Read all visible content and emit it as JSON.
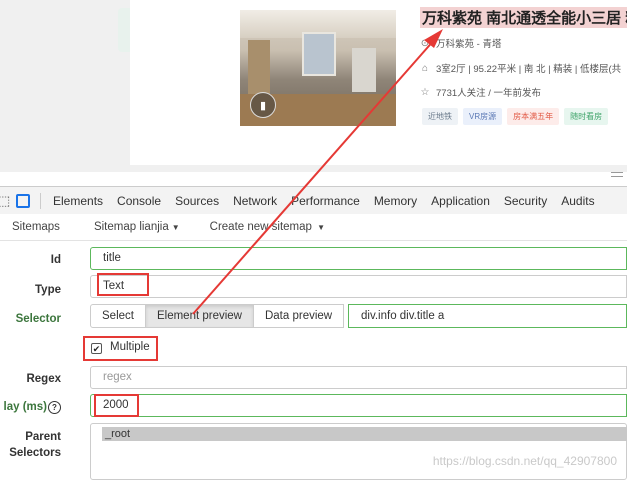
{
  "listing": {
    "title": "万科紫苑 南北通透全能小三居 精",
    "location": "万科紫苑 - 青塔",
    "info": "3室2厅 | 95.22平米 | 南 北 | 精装 | 低楼层(共",
    "follow": "7731人关注 / 一年前发布",
    "tags": [
      "近地铁",
      "VR房源",
      "房本满五年",
      "随时看房"
    ],
    "colors": {
      "title_highlight": "#f3d2d2",
      "tag_vr": "#5a78b5",
      "tag_five_year": "#e25b47",
      "tag_anytime": "#3fa46a"
    }
  },
  "devtools": {
    "tabs": [
      "Elements",
      "Console",
      "Sources",
      "Network",
      "Performance",
      "Memory",
      "Application",
      "Security",
      "Audits"
    ],
    "active_tab_color": "#1a73e8"
  },
  "scraper": {
    "subtabs": {
      "sitemaps": "Sitemaps",
      "sitemap": "Sitemap lianjia",
      "create": "Create new sitemap"
    },
    "form": {
      "id_label": "Id",
      "id_value": "title",
      "type_label": "Type",
      "type_value": "Text",
      "selector_label": "Selector",
      "selector_buttons": [
        "Select",
        "Element preview",
        "Data preview"
      ],
      "selector_value": "div.info div.title a",
      "multiple_label": "Multiple",
      "multiple_checked": "✔",
      "regex_label": "Regex",
      "regex_placeholder": "regex",
      "delay_label": "lay (ms)",
      "delay_value": "2000",
      "parent_label_1": "Parent",
      "parent_label_2": "Selectors",
      "parent_option": "_root"
    },
    "colors": {
      "valid_border": "#5cb85c",
      "annotation_red": "#e53935"
    }
  },
  "watermark": "https://blog.csdn.net/qq_42907800"
}
